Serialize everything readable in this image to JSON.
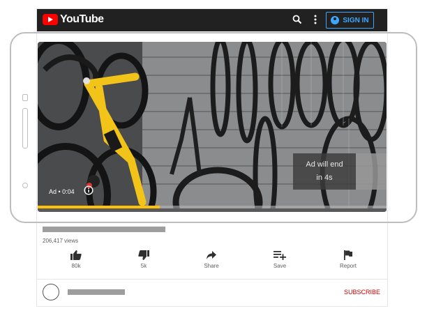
{
  "header": {
    "logo_text": "YouTube",
    "signin_label": "SIGN IN"
  },
  "video": {
    "ad_label": "Ad • 0:04",
    "ad_end_line1": "Ad will end",
    "ad_end_line2": "in 4s",
    "progress_fraction": 0.35
  },
  "meta": {
    "views": "206,417 views"
  },
  "actions": [
    {
      "label": "80k",
      "icon": "thumbs-up-icon"
    },
    {
      "label": "5k",
      "icon": "thumbs-down-icon"
    },
    {
      "label": "Share",
      "icon": "share-icon"
    },
    {
      "label": "Save",
      "icon": "playlist-add-icon"
    },
    {
      "label": "Report",
      "icon": "flag-icon"
    }
  ],
  "channel": {
    "subscribe_label": "SUBSCRIBE"
  },
  "colors": {
    "brand_red": "#ff0000",
    "accent_blue": "#3ea6ff",
    "subscribe_red": "#cc0000",
    "progress_yellow": "#ffc107",
    "bike_yellow": "#f2c318"
  }
}
